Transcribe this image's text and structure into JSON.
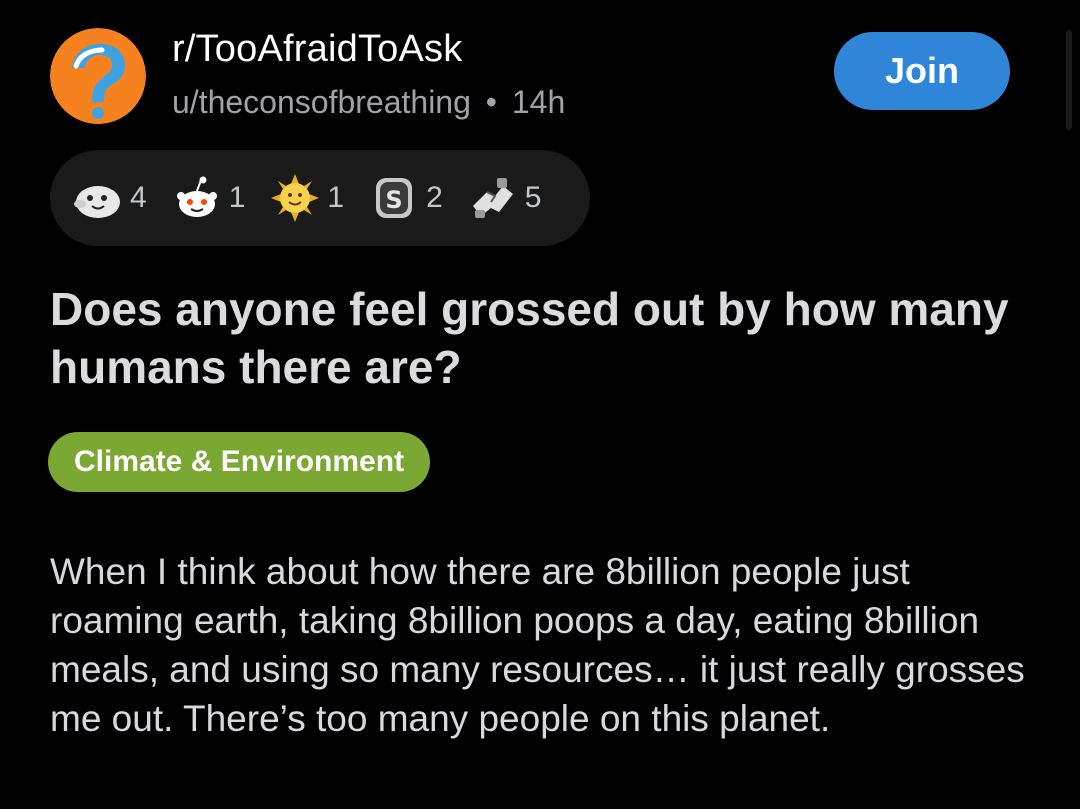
{
  "post": {
    "subreddit": "r/TooAfraidToAsk",
    "author": "u/theconsofbreathing",
    "separator": "•",
    "age": "14h",
    "join_label": "Join",
    "title": "Does anyone feel grossed out by how many humans there are?",
    "flair": "Climate & Environment",
    "body": "When I think about how there are 8billion people just roaming earth, taking 8billion poops a day, eating 8billion meals, and using so many resources… it just really grosses me out. There’s too many people on this planet."
  },
  "awards": [
    {
      "icon": "wholesome-seal-icon",
      "count": "4"
    },
    {
      "icon": "snoo-award-icon",
      "count": "1"
    },
    {
      "icon": "sun-face-award-icon",
      "count": "1"
    },
    {
      "icon": "silver-s-coin-icon",
      "count": "2"
    },
    {
      "icon": "handshake-award-icon",
      "count": "5"
    }
  ],
  "colors": {
    "background": "#000000",
    "join_button": "#2f86d9",
    "flair": "#7ba832",
    "award_bar": "#1a1a1b",
    "subreddit_icon": "#f5821f"
  },
  "icons": {
    "subreddit": "question-mark-subreddit-icon"
  }
}
